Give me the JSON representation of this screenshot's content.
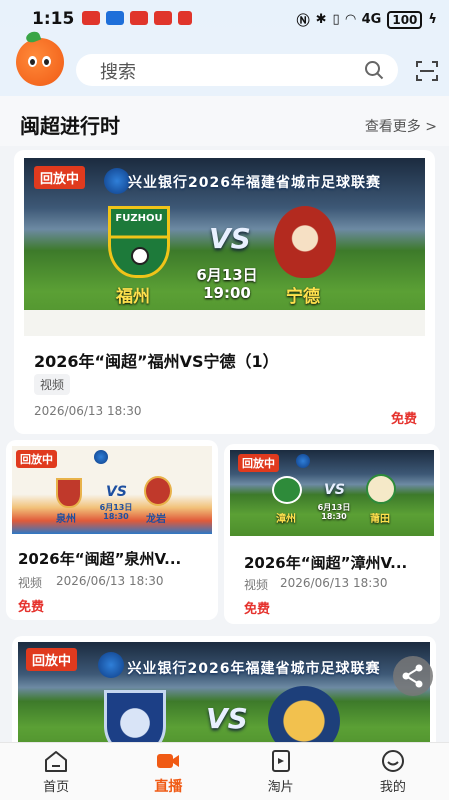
{
  "status_bar": {
    "time": "1:15",
    "battery": "100",
    "network": "4G",
    "app_icon_colors": [
      "#e0352b",
      "#1e6fd9",
      "#e0352b",
      "#e0352b",
      "#e0352b"
    ]
  },
  "header": {
    "search_placeholder": "搜索",
    "logo_icon": "orange-mascot-icon",
    "scan_icon": "scan-icon"
  },
  "section": {
    "title": "闽超进行时",
    "more_label": "查看更多 >"
  },
  "featured": {
    "badge": "回放中",
    "banner_title": "兴业银行2026年福建省城市足球联赛",
    "home_team": "福州",
    "away_team": "宁德",
    "home_crest_text": "FUZHOU",
    "match_date": "6月13日",
    "match_time": "19:00",
    "vs": "VS",
    "title": "2026年“闽超”福州VS宁德（1）",
    "tag": "视频",
    "time": "2026/06/13 18:30",
    "price": "免费"
  },
  "cards": [
    {
      "badge": "回放中",
      "home_team": "泉州",
      "away_team": "龙岩",
      "match_date": "6月13日",
      "match_time": "18:30",
      "vs": "VS",
      "title": "2026年“闽超”泉州V...",
      "tag": "视频",
      "time": "2026/06/13 18:30",
      "price": "免费"
    },
    {
      "badge": "回放中",
      "home_team": "漳州",
      "away_team": "莆田",
      "match_date": "6月13日",
      "match_time": "18:30",
      "vs": "VS",
      "title": "2026年“闽超”漳州V...",
      "tag": "视频",
      "time": "2026/06/13 18:30",
      "price": "免费"
    }
  ],
  "bottom_card": {
    "badge": "回放中",
    "banner_title": "兴业银行2026年福建省城市足球联赛",
    "vs": "VS"
  },
  "tabs": [
    {
      "label": "首页",
      "icon": "home-icon"
    },
    {
      "label": "直播",
      "icon": "live-video-icon",
      "active": true
    },
    {
      "label": "淘片",
      "icon": "film-icon"
    },
    {
      "label": "我的",
      "icon": "profile-smile-icon"
    }
  ],
  "colors": {
    "accent": "#f05a14",
    "badge_red": "#e03a1e",
    "price_red": "#e5322d"
  }
}
